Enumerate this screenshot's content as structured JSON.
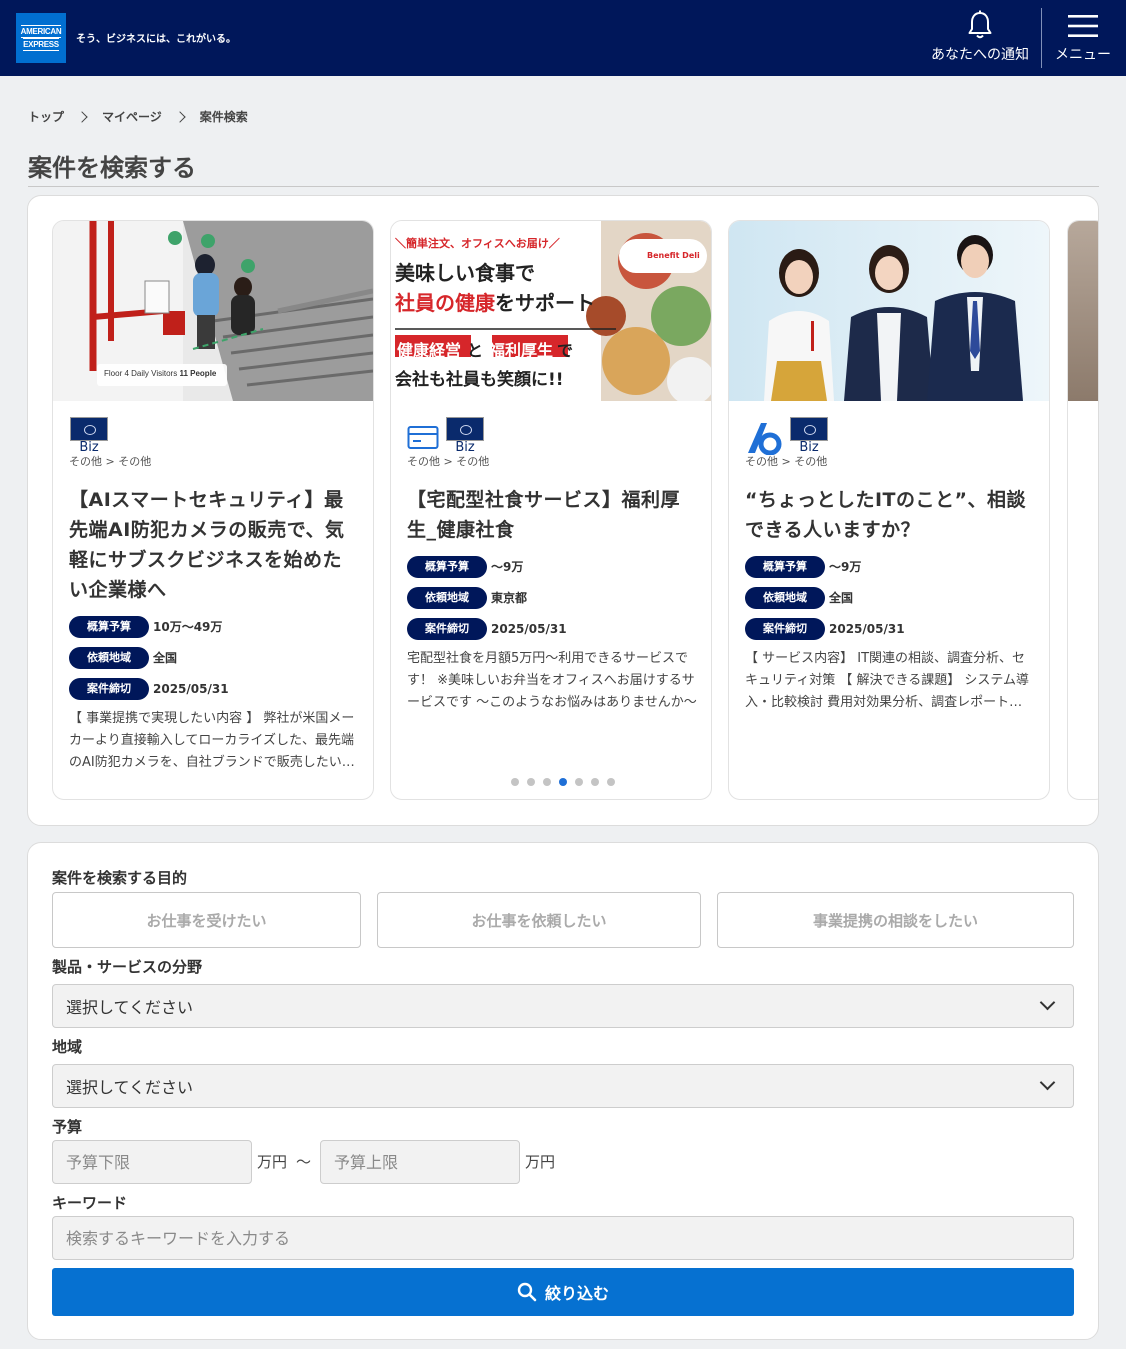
{
  "header": {
    "logo_line1": "AMERICAN",
    "logo_line2": "EXPRESS",
    "tagline": "そう、ビジネスには、これがいる。",
    "notification_label": "あなたへの通知",
    "menu_label": "メニュー",
    "brand_color": "#00175a"
  },
  "breadcrumb": [
    "トップ",
    "マイページ",
    "案件検索"
  ],
  "page_title": "案件を検索する",
  "carousel": {
    "cards": [
      {
        "image_caption_prefix": "Floor 4 Daily Visitors",
        "image_caption_value": "11 People",
        "biz_label": "Biz",
        "category": "その他 > その他",
        "title": "【AIスマートセキュリティ】最先端AI防犯カメラの販売で、気軽にサブスクビジネスを始めたい企業様へ",
        "budget_label": "概算予算",
        "budget": "10万～49万",
        "region_label": "依頼地域",
        "region": "全国",
        "deadline_label": "案件締切",
        "deadline": "2025/05/31",
        "description": "【 事業提携で実現したい内容 】 弊社が米国メーカーより直接輸入してローカライズした、最先端のAI防犯カメラを、自社ブランドで販売したい企業様を募集"
      },
      {
        "image_banner_top": "＼簡単注文、オフィスへお届け／",
        "image_line1": "美味しい食事で",
        "image_line2a": "社員の健康",
        "image_line2b": "をサポート",
        "image_line3a": "健康経営",
        "image_line3b": "と",
        "image_line3c": "福利厚生",
        "image_line3d": "で",
        "image_line4": "会社も社員も笑顔に!!",
        "image_badge": "Benefit Deli",
        "biz_label": "Biz",
        "category": "その他 > その他",
        "title": "【宅配型社食サービス】福利厚生_健康社食",
        "budget_label": "概算予算",
        "budget": "～9万",
        "region_label": "依頼地域",
        "region": "東京都",
        "deadline_label": "案件締切",
        "deadline": "2025/05/31",
        "description": "宅配型社食を月額5万円〜利用できるサービスです！ ※美味しいお弁当をオフィスへお届けするサービスです 〜このようなお悩みはありませんか〜"
      },
      {
        "biz_label": "Biz",
        "category": "その他 > その他",
        "title": "“ちょっとしたITのこと”、相談できる人いますか？",
        "budget_label": "概算予算",
        "budget": "～9万",
        "region_label": "依頼地域",
        "region": "全国",
        "deadline_label": "案件締切",
        "deadline": "2025/05/31",
        "description": "【 サービス内容】 IT関連の相談、調査分析、セキュリティ対策 【 解決できる課題】 システム導入・比較検討 費用対効果分析、調査レポート作成"
      }
    ],
    "dots_total": 7,
    "dots_active_index": 3,
    "accent_color": "#1f6fd6"
  },
  "search": {
    "purpose_label": "案件を検索する目的",
    "purpose_options": [
      "お仕事を受けたい",
      "お仕事を依頼したい",
      "事業提携の相談をしたい"
    ],
    "field_label": "製品・サービスの分野",
    "field_value": "選択してください",
    "region_label": "地域",
    "region_value": "選択してください",
    "budget_label": "予算",
    "budget_min_placeholder": "予算下限",
    "budget_max_placeholder": "予算上限",
    "unit": "万円",
    "range_sep": "〜",
    "keyword_label": "キーワード",
    "keyword_placeholder": "検索するキーワードを入力する",
    "submit_label": "絞り込む",
    "submit_color": "#0671d1"
  }
}
